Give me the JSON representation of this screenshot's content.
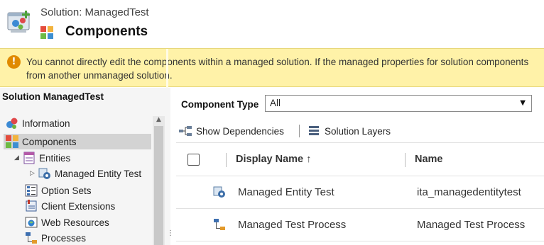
{
  "header": {
    "solution_label": "Solution: ManagedTest",
    "page_title": "Components",
    "solution_icon": "solution-wizard-icon",
    "components_icon": "components-grid-icon"
  },
  "banner": {
    "icon": "warning-icon",
    "line1": "You cannot directly edit the components within a managed solution. If the managed properties for solution components",
    "line2": "from another unmanaged solution."
  },
  "leftnav": {
    "title": "Solution ManagedTest",
    "items": [
      {
        "label": "Information",
        "icon": "information-icon"
      },
      {
        "label": "Components",
        "icon": "components-icon",
        "selected": true
      },
      {
        "label": "Entities",
        "icon": "entities-icon"
      },
      {
        "label": "Managed Entity Test",
        "icon": "entity-gear-icon"
      },
      {
        "label": "Option Sets",
        "icon": "option-sets-icon"
      },
      {
        "label": "Client Extensions",
        "icon": "client-extensions-icon"
      },
      {
        "label": "Web Resources",
        "icon": "web-resources-icon"
      },
      {
        "label": "Processes",
        "icon": "processes-icon"
      }
    ]
  },
  "main": {
    "component_type_label": "Component Type",
    "component_type_value": "All",
    "toolbar": {
      "show_dependencies": "Show Dependencies",
      "solution_layers": "Solution Layers"
    },
    "grid": {
      "columns": {
        "display_name": "Display Name ↑",
        "name": "Name"
      },
      "rows": [
        {
          "display_name": "Managed Entity Test",
          "name": "ita_managedentitytest",
          "icon": "entity-gear-icon"
        },
        {
          "display_name": "Managed Test Process",
          "name": "Managed Test Process",
          "icon": "process-flow-icon"
        }
      ]
    }
  }
}
